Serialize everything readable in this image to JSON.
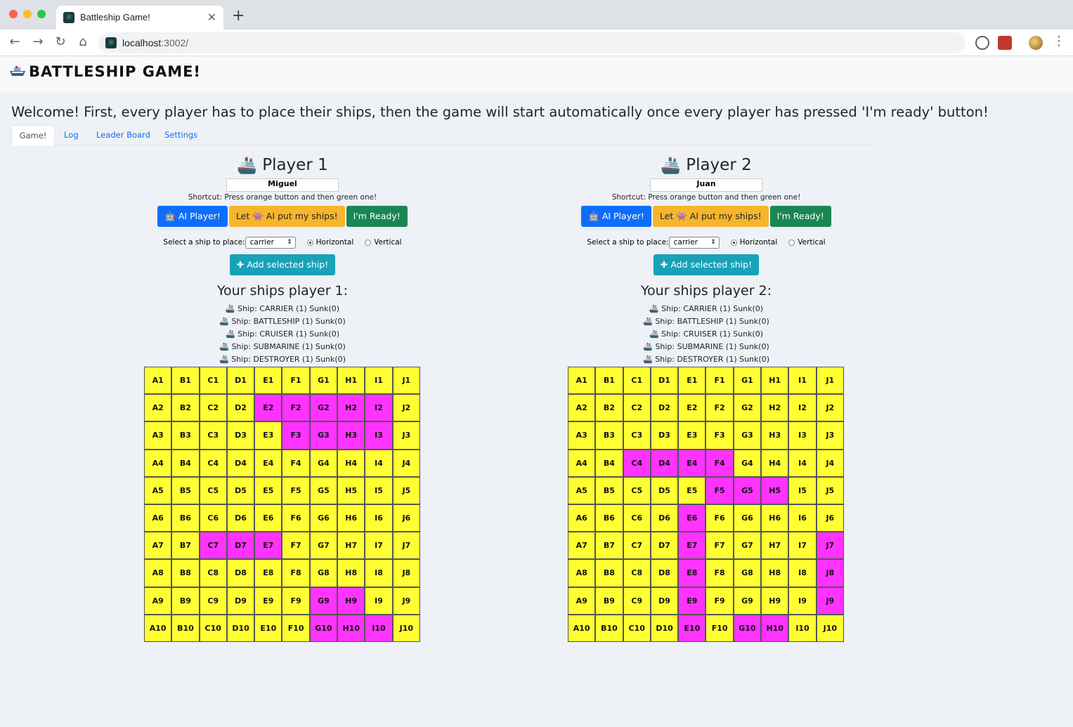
{
  "browser": {
    "tab_title": "Battleship Game!",
    "url_host": "localhost",
    "url_rest": ":3002/"
  },
  "app": {
    "brand": "BATTLESHIP GAME!",
    "welcome": "Welcome! First, every player has to place their ships, then the game will start automatically once every player has pressed 'I'm ready' button!",
    "tabs": [
      "Game!",
      "Log",
      "Leader Board",
      "Settings"
    ]
  },
  "labels": {
    "shortcut": "Shortcut: Press orange button and then green one!",
    "ai_player": "AI Player!",
    "let_ai": "Let 👾 AI put my ships!",
    "ready": "I'm Ready!",
    "select_ship": "Select a ship to place:",
    "horizontal": "Horizontal",
    "vertical": "Vertical",
    "add_ship": "Add selected ship!"
  },
  "players": [
    {
      "title": "Player 1",
      "name": "Miguel",
      "selected_ship": "carrier",
      "orientation": "horizontal",
      "ships_title": "Your ships player 1:",
      "ships": [
        "Ship: CARRIER (1) Sunk(0)",
        "Ship: BATTLESHIP (1) Sunk(0)",
        "Ship: CRUISER (1) Sunk(0)",
        "Ship: SUBMARINE (1) Sunk(0)",
        "Ship: DESTROYER (1) Sunk(0)"
      ],
      "occupied": [
        "E2",
        "F2",
        "G2",
        "H2",
        "I2",
        "F3",
        "G3",
        "H3",
        "I3",
        "C7",
        "D7",
        "E7",
        "G9",
        "H9",
        "G10",
        "H10",
        "I10"
      ]
    },
    {
      "title": "Player 2",
      "name": "Juan",
      "selected_ship": "carrier",
      "orientation": "horizontal",
      "ships_title": "Your ships player 2:",
      "ships": [
        "Ship: CARRIER (1) Sunk(0)",
        "Ship: BATTLESHIP (1) Sunk(0)",
        "Ship: CRUISER (1) Sunk(0)",
        "Ship: SUBMARINE (1) Sunk(0)",
        "Ship: DESTROYER (1) Sunk(0)"
      ],
      "occupied": [
        "C4",
        "D4",
        "E4",
        "F4",
        "F5",
        "G5",
        "H5",
        "E6",
        "E7",
        "E8",
        "E9",
        "E10",
        "J7",
        "J8",
        "J9",
        "G10",
        "H10"
      ]
    }
  ],
  "grid": {
    "cols": [
      "A",
      "B",
      "C",
      "D",
      "E",
      "F",
      "G",
      "H",
      "I",
      "J"
    ],
    "rows": [
      1,
      2,
      3,
      4,
      5,
      6,
      7,
      8,
      9,
      10
    ]
  },
  "colors": {
    "water": "#ffff33",
    "ship": "#ff33ff"
  }
}
